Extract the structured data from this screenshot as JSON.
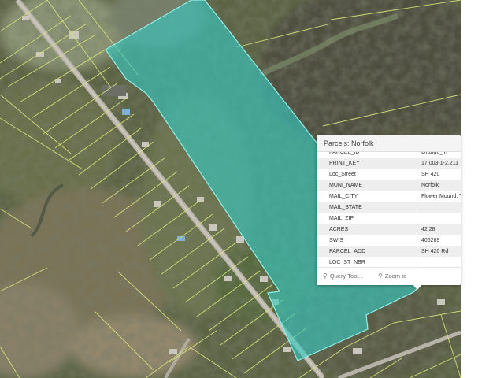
{
  "popup": {
    "title": "Parcels: Norfolk",
    "rows": [
      {
        "key": "PARCEL_ID",
        "value": "Orange_Tr"
      },
      {
        "key": "PRINT_KEY",
        "value": "17.003-1-2.211"
      },
      {
        "key": "Loc_Street",
        "value": "SH 420"
      },
      {
        "key": "MUNI_NAME",
        "value": "Norfolk"
      },
      {
        "key": "MAIL_CITY",
        "value": "Flower Mound, T"
      },
      {
        "key": "MAIL_STATE",
        "value": ""
      },
      {
        "key": "MAIL_ZIP",
        "value": ""
      },
      {
        "key": "ACRES",
        "value": "42.28"
      },
      {
        "key": "SWIS",
        "value": "406289"
      },
      {
        "key": "PARCEL_ADD",
        "value": "SH 420 Rd"
      },
      {
        "key": "LOC_ST_NBR",
        "value": ""
      }
    ],
    "query_tool_label": "Query Tool...",
    "zoom_to_label": "Zoom to",
    "query_tool_icon": "query-icon",
    "zoom_icon": "magnifier-icon"
  },
  "colors": {
    "selected_parcel_fill": "#36c9c1",
    "parcel_lines": "#d9e27a",
    "road": "#b4b0a6"
  }
}
